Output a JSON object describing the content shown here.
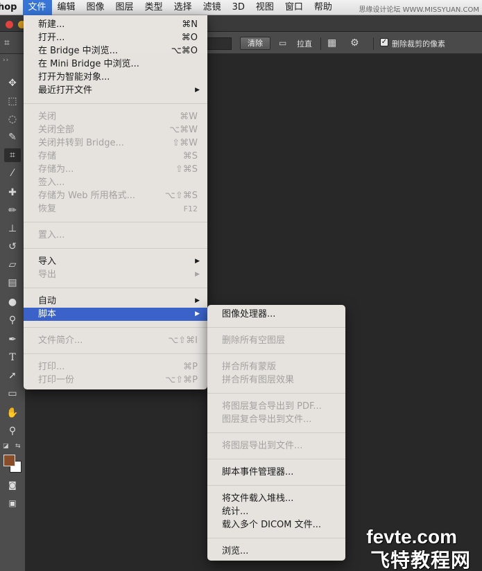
{
  "menubar": {
    "app": "hop",
    "items": [
      "文件",
      "编辑",
      "图像",
      "图层",
      "类型",
      "选择",
      "滤镜",
      "3D",
      "视图",
      "窗口",
      "帮助"
    ],
    "watermark": "思缘设计论坛 WWW.MISSYUAN.COM"
  },
  "options_bar": {
    "clear": "清除",
    "straighten": "拉直",
    "delete_cropped": "删除裁剪的像素"
  },
  "file_menu": {
    "new": {
      "label": "新建...",
      "shortcut": "⌘N"
    },
    "open": {
      "label": "打开...",
      "shortcut": "⌘O"
    },
    "browse_bridge": {
      "label": "在 Bridge 中浏览...",
      "shortcut": "⌥⌘O"
    },
    "browse_mini_bridge": {
      "label": "在 Mini Bridge 中浏览..."
    },
    "open_smart": {
      "label": "打开为智能对象..."
    },
    "recent": {
      "label": "最近打开文件"
    },
    "close": {
      "label": "关闭",
      "shortcut": "⌘W"
    },
    "close_all": {
      "label": "关闭全部",
      "shortcut": "⌥⌘W"
    },
    "close_bridge": {
      "label": "关闭并转到 Bridge...",
      "shortcut": "⇧⌘W"
    },
    "save": {
      "label": "存储",
      "shortcut": "⌘S"
    },
    "save_as": {
      "label": "存储为...",
      "shortcut": "⇧⌘S"
    },
    "check_in": {
      "label": "签入..."
    },
    "save_web": {
      "label": "存储为 Web 所用格式...",
      "shortcut": "⌥⇧⌘S"
    },
    "revert": {
      "label": "恢复",
      "shortcut": "F12"
    },
    "place": {
      "label": "置入..."
    },
    "import": {
      "label": "导入"
    },
    "export": {
      "label": "导出"
    },
    "automate": {
      "label": "自动"
    },
    "scripts": {
      "label": "脚本"
    },
    "file_info": {
      "label": "文件简介...",
      "shortcut": "⌥⇧⌘I"
    },
    "print": {
      "label": "打印...",
      "shortcut": "⌘P"
    },
    "print_one": {
      "label": "打印一份",
      "shortcut": "⌥⇧⌘P"
    }
  },
  "scripts_submenu": {
    "image_processor": "图像处理器...",
    "delete_empty_layers": "删除所有空图层",
    "flatten_masks": "拼合所有蒙版",
    "flatten_effects": "拼合所有图层效果",
    "comps_to_pdf": "将图层复合导出到 PDF...",
    "comps_to_files": "图层复合导出到文件...",
    "layers_to_files": "将图层导出到文件...",
    "event_manager": "脚本事件管理器...",
    "load_into_stack": "将文件载入堆栈...",
    "statistics": "统计...",
    "load_dicom": "载入多个 DICOM 文件...",
    "browse": "浏览..."
  },
  "logo": {
    "line1": "fevte.com",
    "line2": "飞特教程网"
  },
  "colors": {
    "highlight": "#3a62c8",
    "menubar_active": "#3875d7",
    "foreground_swatch": "#8a4d2a",
    "canvas": "#282828"
  }
}
